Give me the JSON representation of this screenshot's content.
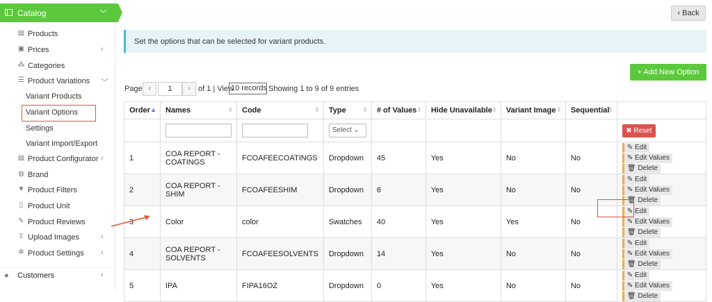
{
  "sidebar": {
    "catalog_label": "Catalog",
    "items": [
      {
        "label": "Products",
        "icon": "list-icon",
        "chevron": ""
      },
      {
        "label": "Prices",
        "icon": "money-icon",
        "chevron": "‹"
      },
      {
        "label": "Categories",
        "icon": "sitemap-icon",
        "chevron": ""
      },
      {
        "label": "Product Variations",
        "icon": "variations-icon",
        "chevron": "﹀"
      }
    ],
    "sub_items": [
      "Variant Products",
      "Variant Options",
      "Settings",
      "Variant Import/Export"
    ],
    "items2": [
      {
        "label": "Product Configurator",
        "icon": "configurator-icon",
        "chevron": "‹"
      },
      {
        "label": "Brand",
        "icon": "brand-icon",
        "chevron": ""
      },
      {
        "label": "Product Filters",
        "icon": "filter-icon",
        "chevron": ""
      },
      {
        "label": "Product Unit",
        "icon": "unit-icon",
        "chevron": ""
      },
      {
        "label": "Product Reviews",
        "icon": "reviews-icon",
        "chevron": ""
      },
      {
        "label": "Upload Images",
        "icon": "upload-icon",
        "chevron": "‹"
      },
      {
        "label": "Product Settings",
        "icon": "gear-icon",
        "chevron": "‹"
      }
    ],
    "customers_label": "Customers"
  },
  "header": {
    "back_label": "‹ Back",
    "info_text": "Set the options that can be selected for variant products.",
    "add_label": "+ Add New Option"
  },
  "pager": {
    "page_label": "Page",
    "page_value": "1",
    "of_label": "of 1 | View",
    "view_value": "10 records",
    "showing_text": "Showing 1 to 9 of 9 entries"
  },
  "table": {
    "columns": [
      "Order",
      "Names",
      "Code",
      "Type",
      "# of Values",
      "Hide Unavailable",
      "Variant Image",
      "Sequential"
    ],
    "type_filter": "Select",
    "reset_label": "✖ Reset",
    "edit_label": "Edit",
    "edit_values_label": "Edit Values",
    "delete_label": "Delete",
    "rows": [
      {
        "order": "1",
        "name": "COA REPORT - COATINGS",
        "code": "FCOAFEECOATINGS",
        "type": "Dropdown",
        "values": "45",
        "hide": "Yes",
        "image": "No",
        "seq": "No"
      },
      {
        "order": "2",
        "name": "COA REPORT - SHIM",
        "code": "FCOAFEESHIM",
        "type": "Dropdown",
        "values": "6",
        "hide": "Yes",
        "image": "No",
        "seq": "No"
      },
      {
        "order": "3",
        "name": "Color",
        "code": "color",
        "type": "Swatches",
        "values": "40",
        "hide": "Yes",
        "image": "Yes",
        "seq": "No"
      },
      {
        "order": "4",
        "name": "COA REPORT - SOLVENTS",
        "code": "FCOAFEESOLVENTS",
        "type": "Dropdown",
        "values": "14",
        "hide": "Yes",
        "image": "No",
        "seq": "No"
      },
      {
        "order": "5",
        "name": "IPA",
        "code": "FIPA16OZ",
        "type": "Dropdown",
        "values": "0",
        "hide": "Yes",
        "image": "No",
        "seq": "No"
      }
    ]
  },
  "colors": {
    "accent_green": "#5cc83c",
    "highlight_red": "#e05535",
    "reset_red": "#d9534f",
    "info_blue": "#e6f4f8"
  }
}
